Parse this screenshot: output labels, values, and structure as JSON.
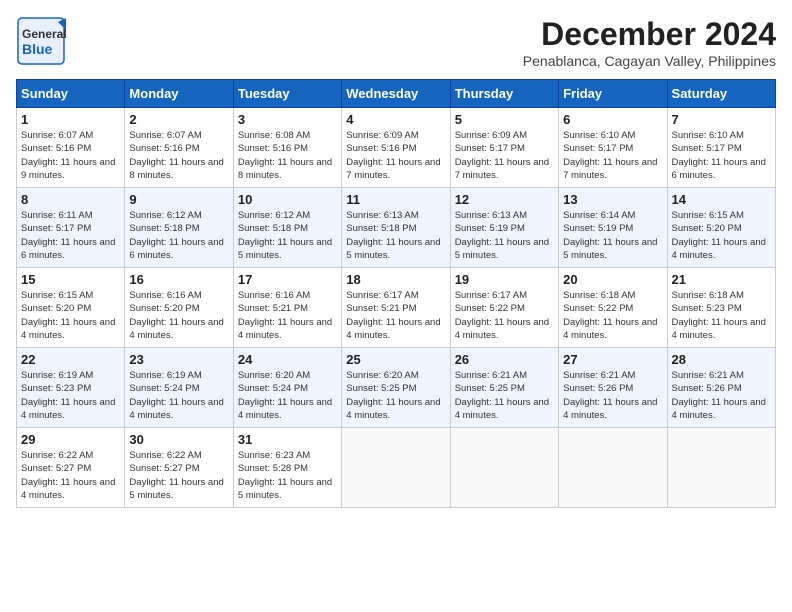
{
  "header": {
    "logo_line1": "General",
    "logo_line2": "Blue",
    "month_title": "December 2024",
    "location": "Penablanca, Cagayan Valley, Philippines"
  },
  "weekdays": [
    "Sunday",
    "Monday",
    "Tuesday",
    "Wednesday",
    "Thursday",
    "Friday",
    "Saturday"
  ],
  "weeks": [
    [
      {
        "day": "1",
        "sunrise": "6:07 AM",
        "sunset": "5:16 PM",
        "daylight": "11 hours and 9 minutes."
      },
      {
        "day": "2",
        "sunrise": "6:07 AM",
        "sunset": "5:16 PM",
        "daylight": "11 hours and 8 minutes."
      },
      {
        "day": "3",
        "sunrise": "6:08 AM",
        "sunset": "5:16 PM",
        "daylight": "11 hours and 8 minutes."
      },
      {
        "day": "4",
        "sunrise": "6:09 AM",
        "sunset": "5:16 PM",
        "daylight": "11 hours and 7 minutes."
      },
      {
        "day": "5",
        "sunrise": "6:09 AM",
        "sunset": "5:17 PM",
        "daylight": "11 hours and 7 minutes."
      },
      {
        "day": "6",
        "sunrise": "6:10 AM",
        "sunset": "5:17 PM",
        "daylight": "11 hours and 7 minutes."
      },
      {
        "day": "7",
        "sunrise": "6:10 AM",
        "sunset": "5:17 PM",
        "daylight": "11 hours and 6 minutes."
      }
    ],
    [
      {
        "day": "8",
        "sunrise": "6:11 AM",
        "sunset": "5:17 PM",
        "daylight": "11 hours and 6 minutes."
      },
      {
        "day": "9",
        "sunrise": "6:12 AM",
        "sunset": "5:18 PM",
        "daylight": "11 hours and 6 minutes."
      },
      {
        "day": "10",
        "sunrise": "6:12 AM",
        "sunset": "5:18 PM",
        "daylight": "11 hours and 5 minutes."
      },
      {
        "day": "11",
        "sunrise": "6:13 AM",
        "sunset": "5:18 PM",
        "daylight": "11 hours and 5 minutes."
      },
      {
        "day": "12",
        "sunrise": "6:13 AM",
        "sunset": "5:19 PM",
        "daylight": "11 hours and 5 minutes."
      },
      {
        "day": "13",
        "sunrise": "6:14 AM",
        "sunset": "5:19 PM",
        "daylight": "11 hours and 5 minutes."
      },
      {
        "day": "14",
        "sunrise": "6:15 AM",
        "sunset": "5:20 PM",
        "daylight": "11 hours and 4 minutes."
      }
    ],
    [
      {
        "day": "15",
        "sunrise": "6:15 AM",
        "sunset": "5:20 PM",
        "daylight": "11 hours and 4 minutes."
      },
      {
        "day": "16",
        "sunrise": "6:16 AM",
        "sunset": "5:20 PM",
        "daylight": "11 hours and 4 minutes."
      },
      {
        "day": "17",
        "sunrise": "6:16 AM",
        "sunset": "5:21 PM",
        "daylight": "11 hours and 4 minutes."
      },
      {
        "day": "18",
        "sunrise": "6:17 AM",
        "sunset": "5:21 PM",
        "daylight": "11 hours and 4 minutes."
      },
      {
        "day": "19",
        "sunrise": "6:17 AM",
        "sunset": "5:22 PM",
        "daylight": "11 hours and 4 minutes."
      },
      {
        "day": "20",
        "sunrise": "6:18 AM",
        "sunset": "5:22 PM",
        "daylight": "11 hours and 4 minutes."
      },
      {
        "day": "21",
        "sunrise": "6:18 AM",
        "sunset": "5:23 PM",
        "daylight": "11 hours and 4 minutes."
      }
    ],
    [
      {
        "day": "22",
        "sunrise": "6:19 AM",
        "sunset": "5:23 PM",
        "daylight": "11 hours and 4 minutes."
      },
      {
        "day": "23",
        "sunrise": "6:19 AM",
        "sunset": "5:24 PM",
        "daylight": "11 hours and 4 minutes."
      },
      {
        "day": "24",
        "sunrise": "6:20 AM",
        "sunset": "5:24 PM",
        "daylight": "11 hours and 4 minutes."
      },
      {
        "day": "25",
        "sunrise": "6:20 AM",
        "sunset": "5:25 PM",
        "daylight": "11 hours and 4 minutes."
      },
      {
        "day": "26",
        "sunrise": "6:21 AM",
        "sunset": "5:25 PM",
        "daylight": "11 hours and 4 minutes."
      },
      {
        "day": "27",
        "sunrise": "6:21 AM",
        "sunset": "5:26 PM",
        "daylight": "11 hours and 4 minutes."
      },
      {
        "day": "28",
        "sunrise": "6:21 AM",
        "sunset": "5:26 PM",
        "daylight": "11 hours and 4 minutes."
      }
    ],
    [
      {
        "day": "29",
        "sunrise": "6:22 AM",
        "sunset": "5:27 PM",
        "daylight": "11 hours and 4 minutes."
      },
      {
        "day": "30",
        "sunrise": "6:22 AM",
        "sunset": "5:27 PM",
        "daylight": "11 hours and 5 minutes."
      },
      {
        "day": "31",
        "sunrise": "6:23 AM",
        "sunset": "5:28 PM",
        "daylight": "11 hours and 5 minutes."
      },
      null,
      null,
      null,
      null
    ]
  ]
}
